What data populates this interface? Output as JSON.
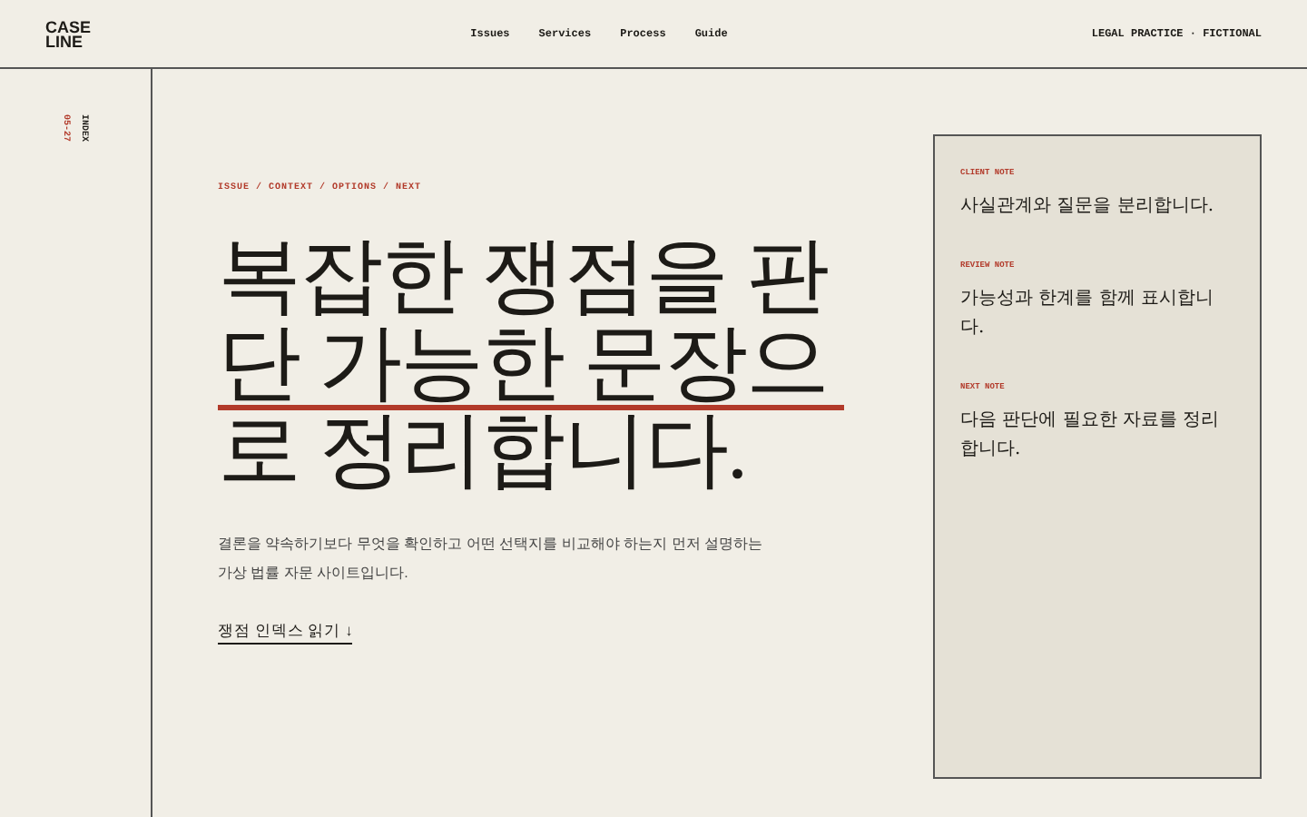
{
  "header": {
    "logo": [
      "CASE",
      "LINE"
    ],
    "nav": [
      "Issues",
      "Services",
      "Process",
      "Guide"
    ],
    "tagline": "LEGAL PRACTICE · FICTIONAL"
  },
  "rail": {
    "label": "INDEX",
    "date": "05-27"
  },
  "hero": {
    "breadcrumb": "ISSUE / CONTEXT / OPTIONS / NEXT",
    "headline": "복잡한 쟁점을 판단 가능한 문장으로 정리합니다.",
    "body": "결론을 약속하기보다 무엇을 확인하고 어떤 선택지를 비교해야 하는지 먼저 설명하는 가상 법률 자문 사이트입니다.",
    "link": "쟁점 인덱스 읽기 ↓"
  },
  "notes": [
    {
      "label": "CLIENT NOTE",
      "text": "사실관계와 질문을 분리합니다."
    },
    {
      "label": "REVIEW NOTE",
      "text": "가능성과 한계를 함께 표시합니다."
    },
    {
      "label": "NEXT NOTE",
      "text": "다음 판단에 필요한 자료를 정리합니다."
    }
  ]
}
